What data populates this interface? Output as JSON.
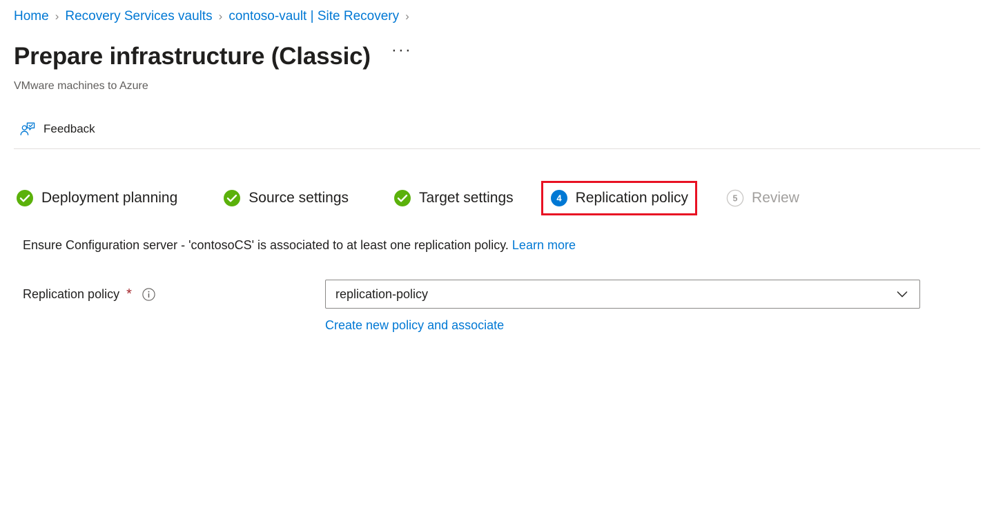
{
  "breadcrumb": {
    "separator": "›",
    "items": [
      {
        "label": "Home"
      },
      {
        "label": "Recovery Services vaults"
      },
      {
        "label": "contoso-vault | Site Recovery"
      }
    ]
  },
  "header": {
    "title": "Prepare infrastructure (Classic)",
    "ellipsis": "···",
    "subtitle": "VMware machines to Azure"
  },
  "commandbar": {
    "feedback": {
      "label": "Feedback",
      "icon": "feedback-person-icon"
    }
  },
  "wizard": {
    "steps": [
      {
        "label": "Deployment planning",
        "state": "complete",
        "icon": "check-circle-icon",
        "number": ""
      },
      {
        "label": "Source settings",
        "state": "complete",
        "icon": "check-circle-icon",
        "number": ""
      },
      {
        "label": "Target settings",
        "state": "complete",
        "icon": "check-circle-icon",
        "number": ""
      },
      {
        "label": "Replication policy",
        "state": "active",
        "icon": "number-circle-icon",
        "number": "4"
      },
      {
        "label": "Review",
        "state": "disabled",
        "icon": "number-circle-icon",
        "number": "5"
      }
    ],
    "highlight_color": "#e81123",
    "active_index": 3
  },
  "main": {
    "instruction_text": "Ensure Configuration server - 'contosoCS' is associated to at least one replication policy.",
    "instruction_link": "Learn more",
    "field": {
      "label": "Replication policy",
      "required_marker": "*",
      "info_icon": "info-circle-icon",
      "dropdown_value": "replication-policy",
      "dropdown_icon": "chevron-down-icon",
      "create_link": "Create new policy and associate"
    }
  },
  "colors": {
    "accent_blue": "#0078d4",
    "success_green": "#5bb10b",
    "highlight_red": "#e81123",
    "required_red": "#a4262c",
    "disabled_gray": "#a19f9d",
    "text_primary": "#201f1e",
    "text_secondary": "#605e5c"
  }
}
